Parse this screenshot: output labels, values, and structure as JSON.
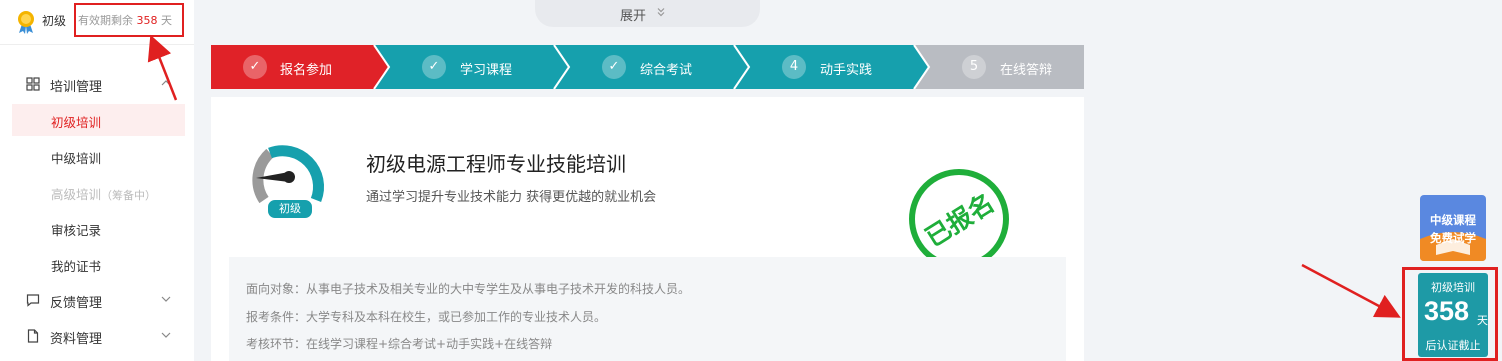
{
  "sidebar": {
    "level": "初级",
    "expiry_prefix": "有效期剩余",
    "expiry_days": "358",
    "expiry_unit": "天",
    "groups": [
      {
        "label": "培训管理",
        "icon": "grid-icon"
      },
      {
        "label": "反馈管理",
        "icon": "comment-icon"
      },
      {
        "label": "资料管理",
        "icon": "document-icon"
      }
    ],
    "items": [
      {
        "label": "初级培训"
      },
      {
        "label": "中级培训"
      },
      {
        "label": "高级培训",
        "note": "（筹备中）"
      },
      {
        "label": "审核记录"
      },
      {
        "label": "我的证书"
      }
    ]
  },
  "expand": {
    "label": "展开"
  },
  "steps": [
    {
      "label": "报名参加",
      "marker": "✓"
    },
    {
      "label": "学习课程",
      "marker": "✓"
    },
    {
      "label": "综合考试",
      "marker": "✓"
    },
    {
      "label": "动手实践",
      "marker": "4"
    },
    {
      "label": "在线答辩",
      "marker": "5"
    }
  ],
  "course": {
    "badge": "初级",
    "title": "初级电源工程师专业技能培训",
    "subtitle": "通过学习提升专业技术能力 获得更优越的就业机会",
    "stamp": "已报名",
    "info": [
      "面向对象：从事电子技术及相关专业的大中专学生及从事电子技术开发的科技人员。",
      "报考条件：大学专科及本科在校生，或已参加工作的专业技术人员。",
      "考核环节：在线学习课程+综合考试+动手实践+在线答辩"
    ]
  },
  "promo": {
    "line1": "中级课程",
    "line2": "免费试学"
  },
  "countdown": {
    "title": "初级培训",
    "days": "358",
    "unit": "天",
    "footer": "后认证截止"
  },
  "colors": {
    "accent_red": "#e02020",
    "teal": "#16a0ad",
    "pending_gray": "#b9bcc2",
    "stamp_green": "#1fae3a"
  }
}
